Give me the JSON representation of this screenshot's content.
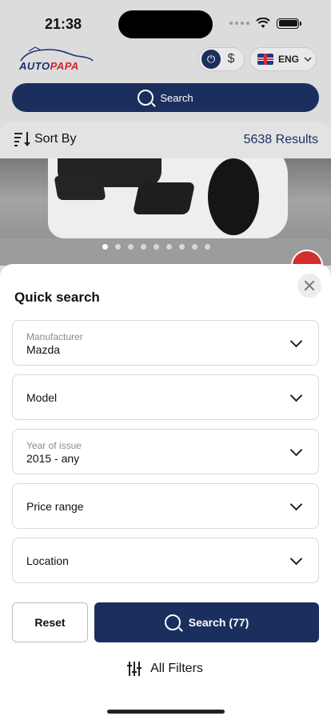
{
  "status": {
    "time": "21:38"
  },
  "header": {
    "logo": {
      "part1": "AUTO",
      "part2": "PAPA"
    },
    "currency": {
      "active_symbol": "⏻",
      "inactive_symbol": "$"
    },
    "language": {
      "code": "ENG"
    }
  },
  "search": {
    "label": "Search"
  },
  "sortbar": {
    "sort_label": "Sort By",
    "results_label": "5638 Results"
  },
  "carousel": {
    "pages": 9,
    "active": 0
  },
  "quick_search": {
    "title": "Quick search",
    "fields": [
      {
        "label": "Manufacturer",
        "value": "Mazda"
      },
      {
        "label": "Model",
        "value": ""
      },
      {
        "label": "Year of issue",
        "value": "2015 - any"
      },
      {
        "label": "Price range",
        "value": ""
      },
      {
        "label": "Location",
        "value": ""
      }
    ],
    "reset_label": "Reset",
    "search_label": "Search (77)",
    "all_filters_label": "All Filters"
  },
  "colors": {
    "primary": "#1b2f5e",
    "accent_red": "#d32f2f"
  }
}
